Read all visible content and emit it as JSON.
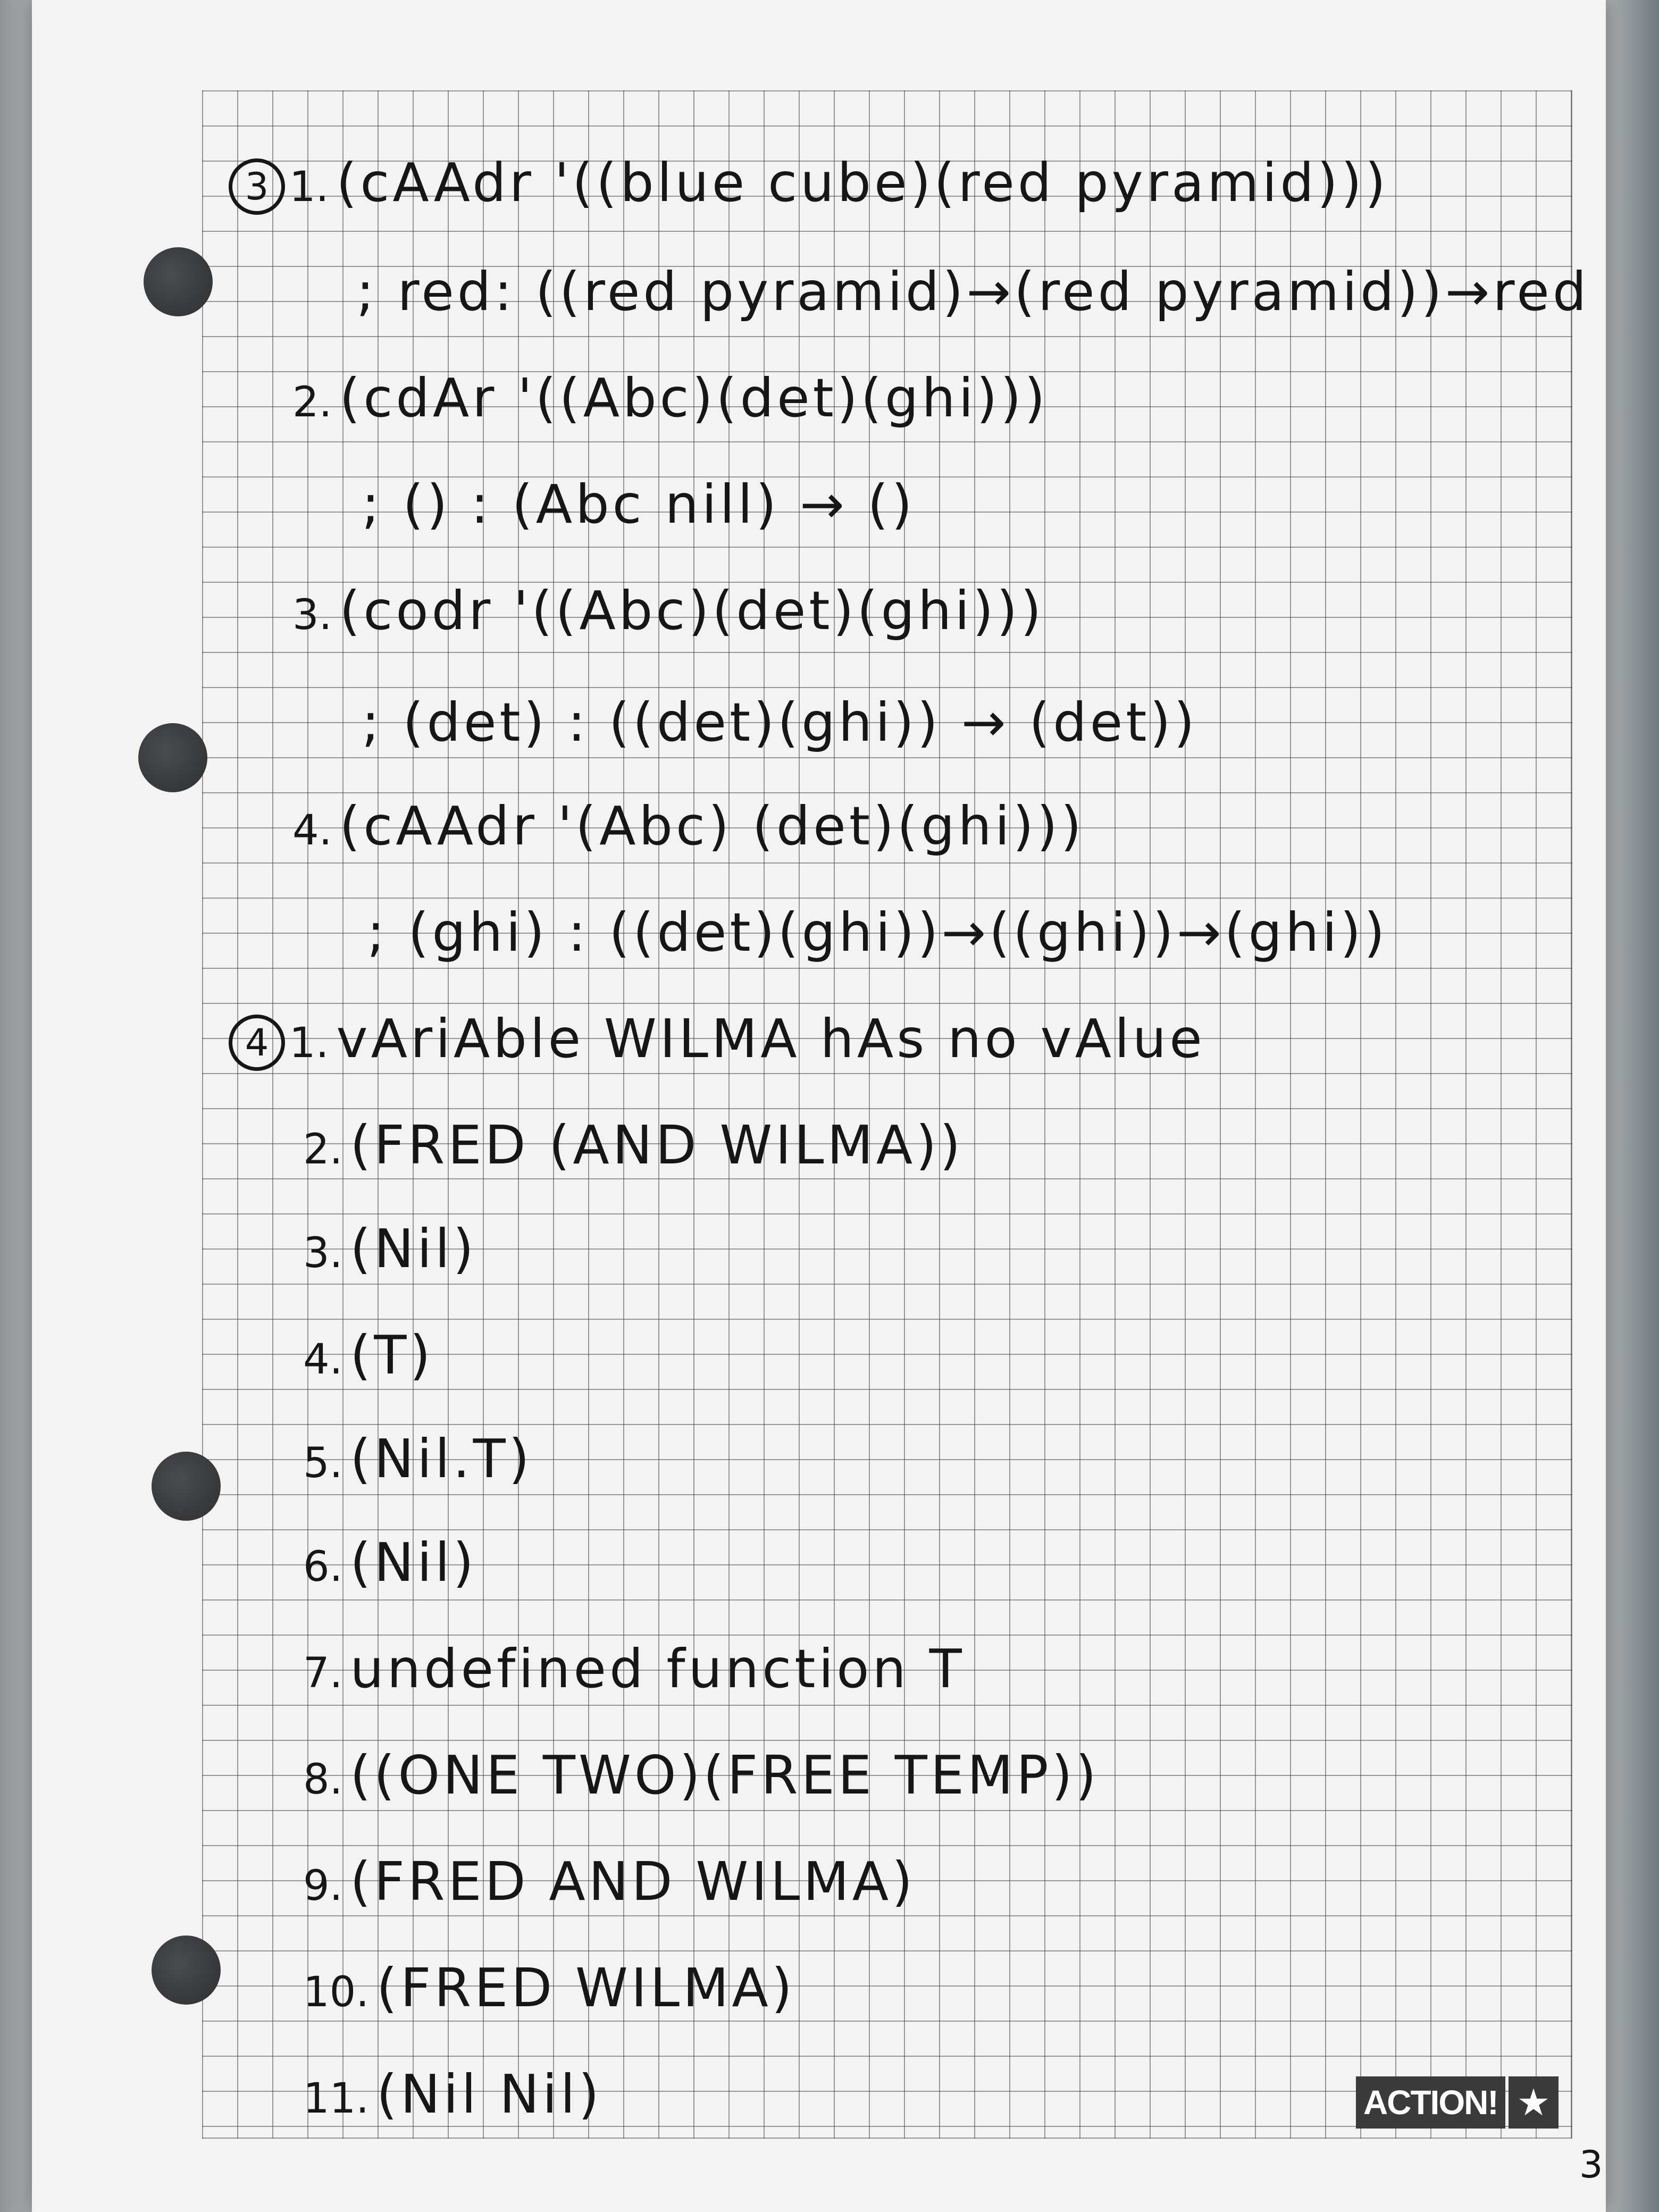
{
  "sheet": {
    "page_number": "3",
    "logo": {
      "text": "ACTION!",
      "star_icon": "star-icon"
    }
  },
  "sections": [
    {
      "marker": "3",
      "lines": [
        {
          "num": "1.",
          "text": "(cAAdr '((blue cube)(red pyramid)))"
        },
        {
          "num": "",
          "text": "; red: ((red pyramid)→(red pyramid))→red"
        },
        {
          "num": "2.",
          "text": "(cdAr '((Abc)(det)(ghi)))"
        },
        {
          "num": "",
          "text": "; () : (Abc nill) → ()"
        },
        {
          "num": "3.",
          "text": "(codr '((Abc)(det)(ghi)))"
        },
        {
          "num": "",
          "text": "; (det) : ((det)(ghi)) → (det))"
        },
        {
          "num": "4.",
          "text": "(cAAdr '(Abc) (det)(ghi)))"
        },
        {
          "num": "",
          "text": "; (ghi) : ((det)(ghi))→((ghi))→(ghi))"
        }
      ]
    },
    {
      "marker": "4",
      "lines": [
        {
          "num": "1.",
          "text": "vAriAble WILMA hAs no vAlue"
        },
        {
          "num": "2.",
          "text": "(FRED (AND WILMA))"
        },
        {
          "num": "3.",
          "text": "(Nil)"
        },
        {
          "num": "4.",
          "text": "(T)"
        },
        {
          "num": "5.",
          "text": "(Nil.T)"
        },
        {
          "num": "6.",
          "text": "(Nil)"
        },
        {
          "num": "7.",
          "text": "undefined function T"
        },
        {
          "num": "8.",
          "text": "((ONE TWO)(FREE TEMP))"
        },
        {
          "num": "9.",
          "text": "(FRED AND WILMA)"
        },
        {
          "num": "10.",
          "text": "(FRED WILMA)"
        },
        {
          "num": "11.",
          "text": "(Nil Nil)"
        }
      ]
    }
  ]
}
